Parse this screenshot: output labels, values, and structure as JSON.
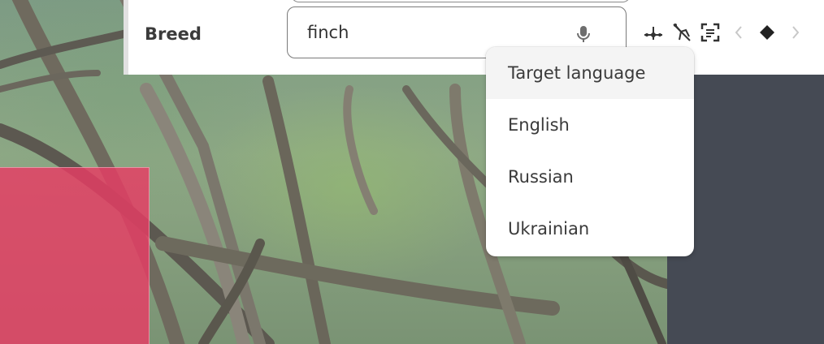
{
  "form": {
    "field_label": "Breed",
    "search_value": "finch"
  },
  "toolbar": {
    "icons": [
      "keypoint-icon",
      "no-pose-icon",
      "scan-text-icon",
      "chevron-left-icon",
      "diamond-icon",
      "chevron-right-icon"
    ]
  },
  "dropdown": {
    "header": "Target language",
    "options": [
      "English",
      "Russian",
      "Ukrainian"
    ]
  },
  "colors": {
    "annotation": "#e83c64",
    "panel": "#454a54"
  }
}
